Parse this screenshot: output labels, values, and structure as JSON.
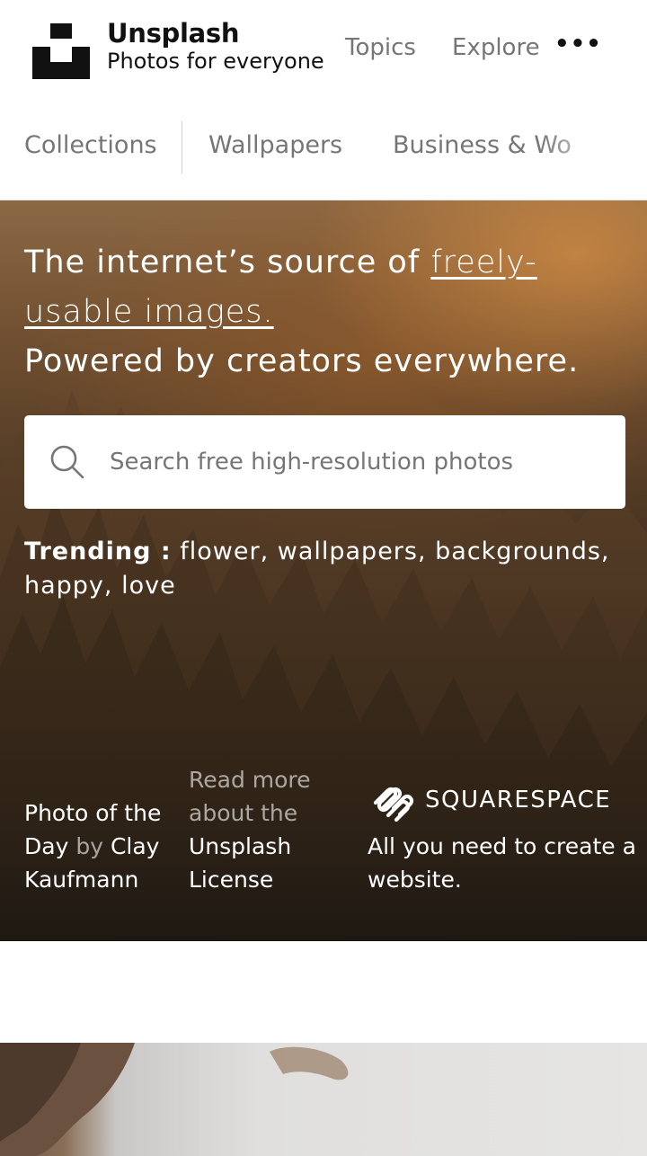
{
  "header": {
    "brand_name": "Unsplash",
    "brand_tagline": "Photos for everyone",
    "nav": {
      "topics": "Topics",
      "explore": "Explore",
      "more": "•••"
    }
  },
  "tabs": [
    "Collections",
    "Wallpapers",
    "Business & Wo"
  ],
  "hero": {
    "headline_pre": "The internet’s source of ",
    "headline_link": "freely-usable images.",
    "headline_post": "Powered by creators everywhere.",
    "search_placeholder": "Search free high-resolution photos",
    "trending_label": "Trending :",
    "trending_keywords": [
      "flower",
      "wallpapers",
      "backgrounds",
      "happy",
      "love"
    ],
    "photo_of_day_lead": "Photo of the Day",
    "photo_of_day_by": "by",
    "photographer": "Clay Kaufmann",
    "license_pre": "Read more about the",
    "license_link": "Unsplash License",
    "sponsor_name": "SQUARESPACE",
    "sponsor_tagline": "All you need to create a website."
  },
  "colors": {
    "nav_gray": "#767676",
    "text_dark": "#111111",
    "white": "#ffffff"
  }
}
